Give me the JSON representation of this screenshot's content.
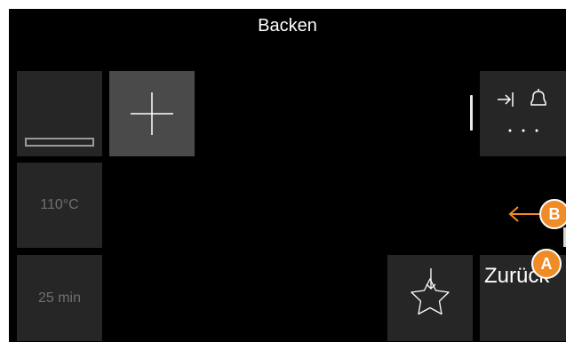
{
  "header": {
    "title": "Backen"
  },
  "tiles": {
    "temperature": "110°C",
    "duration": "25 min",
    "back_label": "Zurück"
  },
  "annotations": {
    "a": "A",
    "b": "B"
  },
  "colors": {
    "accent": "#f08c28",
    "tile": "#262626",
    "tile_selected": "#4a4a4a",
    "muted_text": "#6f6f6f"
  },
  "icons": {
    "heating_mode": "heating-element-icon",
    "add": "plus-icon",
    "timer_and_more": "timer-icon, bell-icon, more-icon",
    "favorite": "star-download-icon",
    "arrow": "arrow-left-icon"
  }
}
